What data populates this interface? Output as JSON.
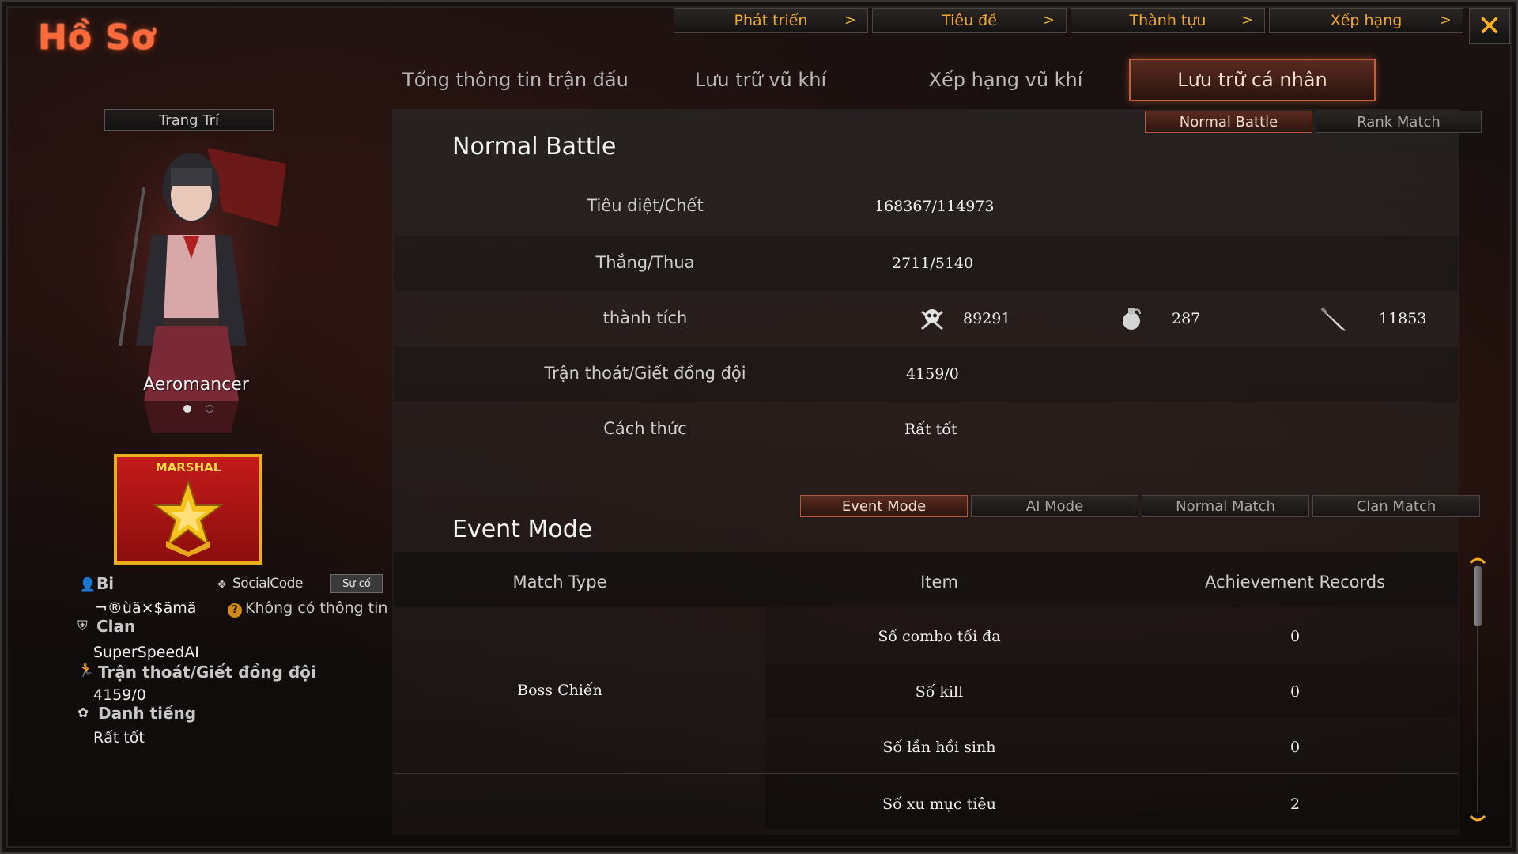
{
  "title": "Hồ Sơ",
  "top_nav": [
    {
      "label": "Phát triển",
      "chevron": ">"
    },
    {
      "label": "Tiêu đề",
      "chevron": ">"
    },
    {
      "label": "Thành tựu",
      "chevron": ">"
    },
    {
      "label": "Xếp hạng",
      "chevron": ">"
    }
  ],
  "close_label": "✕",
  "main_tabs": [
    {
      "label": "Tổng thông tin trận đấu",
      "active": false
    },
    {
      "label": "Lưu trữ vũ khí",
      "active": false
    },
    {
      "label": "Xếp hạng vũ khí",
      "active": false
    },
    {
      "label": "Lưu trữ cá nhân",
      "active": true
    }
  ],
  "left_panel": {
    "decorate_button": "Trang Trí",
    "character_name": "Aeromancer",
    "rank_label": "MARSHAL",
    "username_label": "Bi",
    "username_value": "¬®ùä×$ämä",
    "social_code_label": "SocialCode",
    "social_button": "Sự cố",
    "no_info_text": "Không có thông tin",
    "clan_label": "Clan",
    "clan_value": "SuperSpeedAI",
    "desert_label": "Trận thoát/Giết đồng đội",
    "desert_value": "4159/0",
    "reputation_label": "Danh tiếng",
    "reputation_value": "Rất tốt"
  },
  "battle_tabs": [
    {
      "label": "Normal Battle",
      "active": true
    },
    {
      "label": "Rank Match",
      "active": false
    }
  ],
  "normal_battle": {
    "title": "Normal Battle",
    "rows": [
      {
        "label": "Tiêu diệt/Chết",
        "value": "168367/114973"
      },
      {
        "label": "Thắng/Thua",
        "value": "2711/5140"
      },
      {
        "label": "thành tích",
        "value": ""
      },
      {
        "label": "Trận thoát/Giết đồng đội",
        "value": "4159/0"
      },
      {
        "label": "Cách thức",
        "value": "Rất tốt"
      }
    ],
    "achievements": [
      {
        "icon": "skull-crossbones-icon",
        "value": "89291"
      },
      {
        "icon": "grenade-icon",
        "value": "287"
      },
      {
        "icon": "knife-icon",
        "value": "11853"
      }
    ]
  },
  "mode_tabs": [
    {
      "label": "Event Mode",
      "active": true
    },
    {
      "label": "AI Mode",
      "active": false
    },
    {
      "label": "Normal Match",
      "active": false
    },
    {
      "label": "Clan Match",
      "active": false
    }
  ],
  "event_mode": {
    "title": "Event Mode",
    "headers": [
      "Match Type",
      "Item",
      "Achievement Records"
    ],
    "match_type": "Boss Chiến",
    "rows": [
      {
        "item": "Số combo tối đa",
        "value": "0"
      },
      {
        "item": "Số kill",
        "value": "0"
      },
      {
        "item": "Số lần hồi sinh",
        "value": "0"
      },
      {
        "item": "Số xu mục tiêu",
        "value": "2"
      }
    ]
  },
  "colors": {
    "title": "#ff6a3a",
    "nav_text": "#f0a830",
    "active_tab_border": "#c06040",
    "close": "#ffb21c",
    "rank_badge": "#c41a1a",
    "rank_badge_border": "#e8b01c"
  }
}
